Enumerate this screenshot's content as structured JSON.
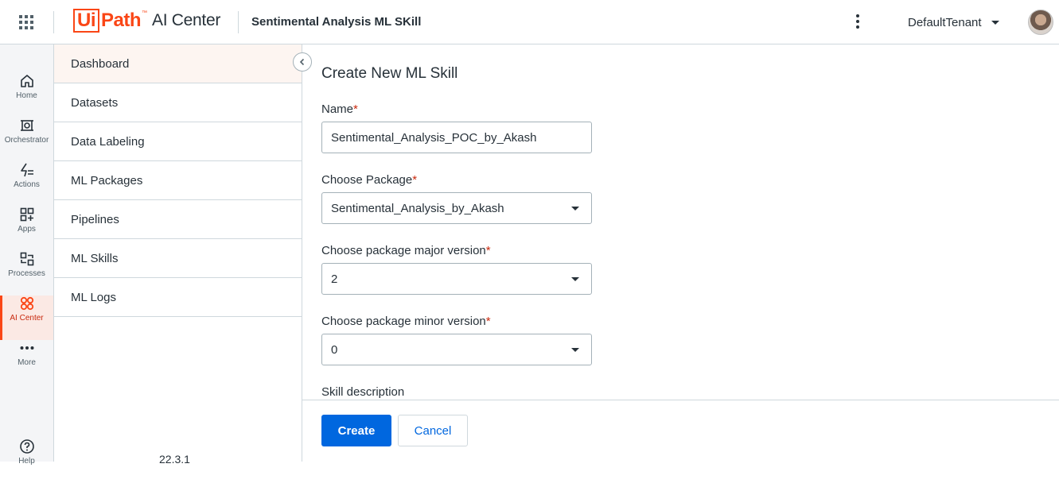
{
  "header": {
    "logo_ui": "Ui",
    "logo_path": "Path",
    "logo_tm": "™",
    "logo_product": "AI Center",
    "service_title": "Sentimental Analysis ML SKill",
    "tenant": "DefaultTenant",
    "icons": {
      "apps": "grid-apps-icon",
      "menu": "kebab-menu-icon",
      "tenant_caret": "caret-down-icon",
      "avatar": "user-avatar"
    }
  },
  "rail": {
    "items": [
      {
        "label": "Home",
        "icon": "home-icon"
      },
      {
        "label": "Orchestrator",
        "icon": "orchestrator-icon"
      },
      {
        "label": "Actions",
        "icon": "actions-icon"
      },
      {
        "label": "Apps",
        "icon": "apps-icon"
      },
      {
        "label": "Processes",
        "icon": "processes-icon"
      },
      {
        "label": "AI Center",
        "icon": "ai-center-icon",
        "active": true
      },
      {
        "label": "More",
        "icon": "more-icon"
      },
      {
        "label": "Help",
        "icon": "help-icon"
      }
    ]
  },
  "subnav": {
    "items": [
      {
        "label": "Dashboard",
        "active": true
      },
      {
        "label": "Datasets"
      },
      {
        "label": "Data Labeling"
      },
      {
        "label": "ML Packages"
      },
      {
        "label": "Pipelines"
      },
      {
        "label": "ML Skills"
      },
      {
        "label": "ML Logs"
      }
    ],
    "version": "22.3.1"
  },
  "form": {
    "title": "Create New ML Skill",
    "required_marker": "*",
    "name": {
      "label": "Name",
      "value": "Sentimental_Analysis_POC_by_Akash"
    },
    "package": {
      "label": "Choose Package",
      "value": "Sentimental_Analysis_by_Akash"
    },
    "major_version": {
      "label": "Choose package major version",
      "value": "2"
    },
    "minor_version": {
      "label": "Choose package minor version",
      "value": "0"
    },
    "description": {
      "label": "Skill description"
    }
  },
  "footer": {
    "create_label": "Create",
    "cancel_label": "Cancel"
  },
  "colors": {
    "brand": "#fa4616",
    "primary": "#0067df",
    "required": "#c8290e",
    "border": "#cfd8dd"
  }
}
